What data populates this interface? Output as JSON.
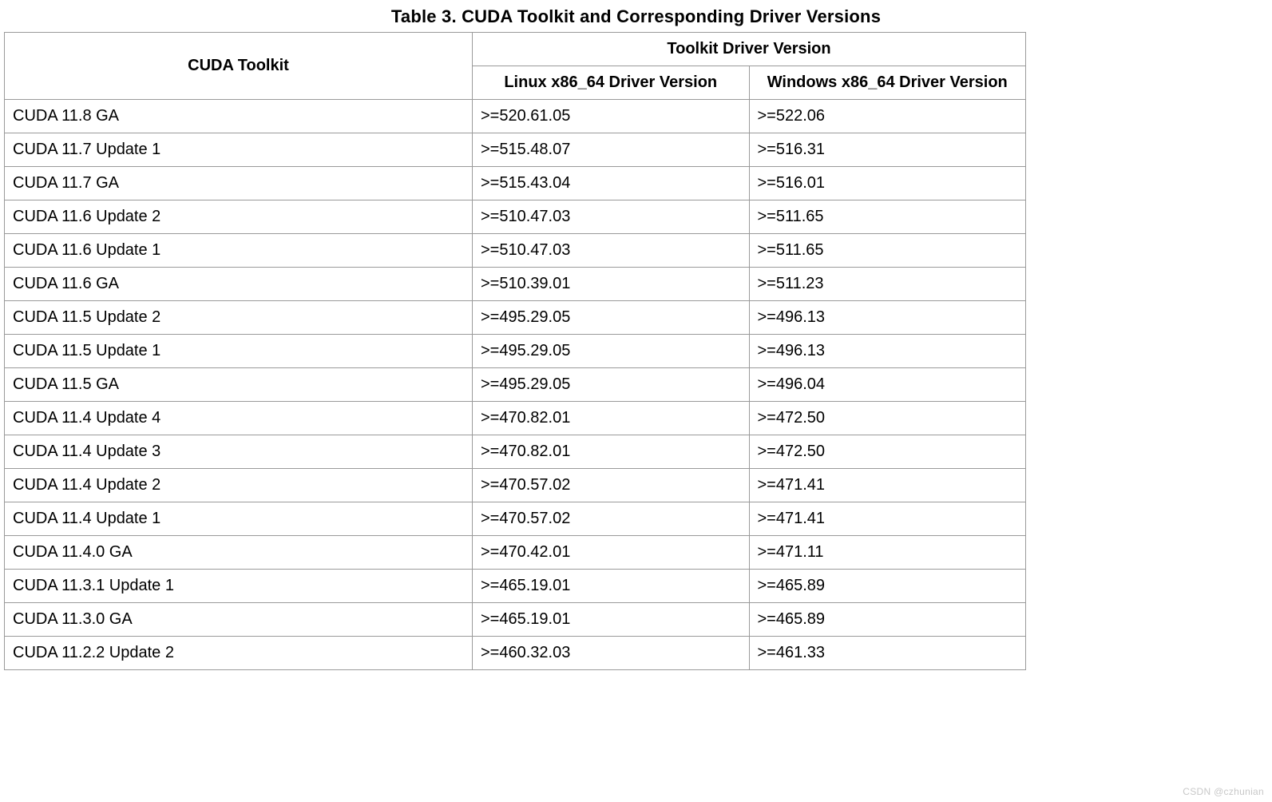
{
  "caption": "Table 3. CUDA Toolkit and Corresponding Driver Versions",
  "headers": {
    "toolkit": "CUDA Toolkit",
    "driver_group": "Toolkit Driver Version",
    "linux": "Linux x86_64 Driver Version",
    "windows": "Windows x86_64 Driver Version"
  },
  "rows": [
    {
      "toolkit": "CUDA 11.8 GA",
      "linux": ">=520.61.05",
      "windows": ">=522.06"
    },
    {
      "toolkit": "CUDA 11.7 Update 1",
      "linux": ">=515.48.07",
      "windows": ">=516.31"
    },
    {
      "toolkit": "CUDA 11.7 GA",
      "linux": ">=515.43.04",
      "windows": ">=516.01"
    },
    {
      "toolkit": "CUDA 11.6 Update 2",
      "linux": ">=510.47.03",
      "windows": ">=511.65"
    },
    {
      "toolkit": "CUDA 11.6 Update 1",
      "linux": ">=510.47.03",
      "windows": ">=511.65"
    },
    {
      "toolkit": "CUDA 11.6 GA",
      "linux": ">=510.39.01",
      "windows": ">=511.23"
    },
    {
      "toolkit": "CUDA 11.5 Update 2",
      "linux": ">=495.29.05",
      "windows": ">=496.13"
    },
    {
      "toolkit": "CUDA 11.5 Update 1",
      "linux": ">=495.29.05",
      "windows": ">=496.13"
    },
    {
      "toolkit": "CUDA 11.5 GA",
      "linux": ">=495.29.05",
      "windows": ">=496.04"
    },
    {
      "toolkit": "CUDA 11.4 Update 4",
      "linux": ">=470.82.01",
      "windows": ">=472.50"
    },
    {
      "toolkit": "CUDA 11.4 Update 3",
      "linux": ">=470.82.01",
      "windows": ">=472.50"
    },
    {
      "toolkit": "CUDA 11.4 Update 2",
      "linux": ">=470.57.02",
      "windows": ">=471.41"
    },
    {
      "toolkit": "CUDA 11.4 Update 1",
      "linux": ">=470.57.02",
      "windows": ">=471.41"
    },
    {
      "toolkit": "CUDA 11.4.0 GA",
      "linux": ">=470.42.01",
      "windows": ">=471.11"
    },
    {
      "toolkit": "CUDA 11.3.1 Update 1",
      "linux": ">=465.19.01",
      "windows": ">=465.89"
    },
    {
      "toolkit": "CUDA 11.3.0 GA",
      "linux": ">=465.19.01",
      "windows": ">=465.89"
    },
    {
      "toolkit": "CUDA 11.2.2 Update 2",
      "linux": ">=460.32.03",
      "windows": ">=461.33"
    }
  ],
  "watermark": "CSDN @czhunian"
}
